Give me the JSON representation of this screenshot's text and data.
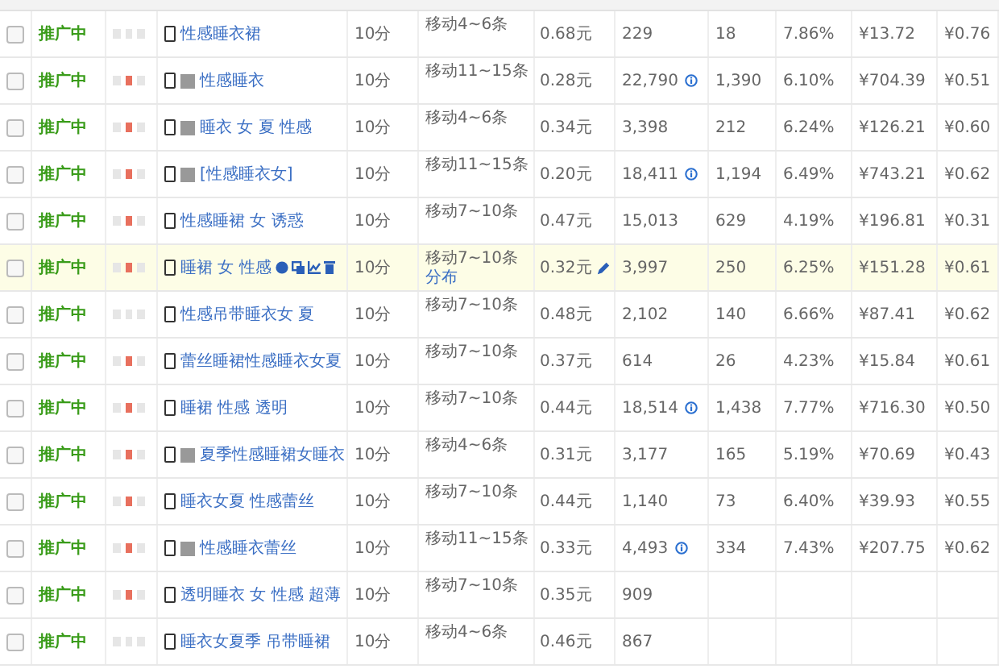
{
  "rows": [
    {
      "checked": false,
      "status": "推广中",
      "flag": false,
      "pc": false,
      "keyword": "性感睡衣裙",
      "score": "10分",
      "ranking": "移动4~6条",
      "bid": "0.68元",
      "impressions": "229",
      "info": false,
      "clicks": "18",
      "ctr": "7.86%",
      "cost": "¥13.72",
      "cpc": "¥0.76",
      "highlighted": false
    },
    {
      "checked": false,
      "status": "推广中",
      "flag": true,
      "pc": true,
      "keyword": "性感睡衣",
      "score": "10分",
      "ranking": "移动11~15条",
      "bid": "0.28元",
      "impressions": "22,790",
      "info": true,
      "clicks": "1,390",
      "ctr": "6.10%",
      "cost": "¥704.39",
      "cpc": "¥0.51",
      "highlighted": false
    },
    {
      "checked": false,
      "status": "推广中",
      "flag": true,
      "pc": true,
      "keyword": "睡衣 女 夏 性感",
      "score": "10分",
      "ranking": "移动4~6条",
      "bid": "0.34元",
      "impressions": "3,398",
      "info": false,
      "clicks": "212",
      "ctr": "6.24%",
      "cost": "¥126.21",
      "cpc": "¥0.60",
      "highlighted": false
    },
    {
      "checked": false,
      "status": "推广中",
      "flag": true,
      "pc": true,
      "keyword": "[性感睡衣女]",
      "score": "10分",
      "ranking": "移动11~15条",
      "bid": "0.20元",
      "impressions": "18,411",
      "info": true,
      "clicks": "1,194",
      "ctr": "6.49%",
      "cost": "¥743.21",
      "cpc": "¥0.62",
      "highlighted": false
    },
    {
      "checked": false,
      "status": "推广中",
      "flag": true,
      "pc": false,
      "keyword": "性感睡裙 女 诱惑",
      "score": "10分",
      "ranking": "移动7~10条",
      "bid": "0.47元",
      "impressions": "15,013",
      "info": false,
      "clicks": "629",
      "ctr": "4.19%",
      "cost": "¥196.81",
      "cpc": "¥0.31",
      "highlighted": false
    },
    {
      "checked": false,
      "status": "推广中",
      "flag": true,
      "pc": false,
      "keyword": "睡裙 女 性感",
      "score": "10分",
      "ranking": "移动7~10条",
      "ranking_link": "分布",
      "bid": "0.32元",
      "impressions": "3,997",
      "info": false,
      "clicks": "250",
      "ctr": "6.25%",
      "cost": "¥151.28",
      "cpc": "¥0.61",
      "highlighted": true
    },
    {
      "checked": false,
      "status": "推广中",
      "flag": false,
      "pc": false,
      "keyword": "性感吊带睡衣女 夏",
      "score": "10分",
      "ranking": "移动7~10条",
      "bid": "0.48元",
      "impressions": "2,102",
      "info": false,
      "clicks": "140",
      "ctr": "6.66%",
      "cost": "¥87.41",
      "cpc": "¥0.62",
      "highlighted": false
    },
    {
      "checked": false,
      "status": "推广中",
      "flag": true,
      "pc": false,
      "keyword": "蕾丝睡裙性感睡衣女夏",
      "score": "10分",
      "ranking": "移动7~10条",
      "bid": "0.37元",
      "impressions": "614",
      "info": false,
      "clicks": "26",
      "ctr": "4.23%",
      "cost": "¥15.84",
      "cpc": "¥0.61",
      "highlighted": false
    },
    {
      "checked": false,
      "status": "推广中",
      "flag": true,
      "pc": false,
      "keyword": "睡裙 性感 透明",
      "score": "10分",
      "ranking": "移动7~10条",
      "bid": "0.44元",
      "impressions": "18,514",
      "info": true,
      "clicks": "1,438",
      "ctr": "7.77%",
      "cost": "¥716.30",
      "cpc": "¥0.50",
      "highlighted": false
    },
    {
      "checked": false,
      "status": "推广中",
      "flag": true,
      "pc": true,
      "keyword": "夏季性感睡裙女睡衣",
      "score": "10分",
      "ranking": "移动4~6条",
      "bid": "0.31元",
      "impressions": "3,177",
      "info": false,
      "clicks": "165",
      "ctr": "5.19%",
      "cost": "¥70.69",
      "cpc": "¥0.43",
      "highlighted": false
    },
    {
      "checked": false,
      "status": "推广中",
      "flag": true,
      "pc": false,
      "keyword": "睡衣女夏 性感蕾丝",
      "score": "10分",
      "ranking": "移动7~10条",
      "bid": "0.44元",
      "impressions": "1,140",
      "info": false,
      "clicks": "73",
      "ctr": "6.40%",
      "cost": "¥39.93",
      "cpc": "¥0.55",
      "highlighted": false
    },
    {
      "checked": false,
      "status": "推广中",
      "flag": true,
      "pc": true,
      "keyword": "性感睡衣蕾丝",
      "score": "10分",
      "ranking": "移动11~15条",
      "bid": "0.33元",
      "impressions": "4,493",
      "info": true,
      "clicks": "334",
      "ctr": "7.43%",
      "cost": "¥207.75",
      "cpc": "¥0.62",
      "highlighted": false
    },
    {
      "checked": false,
      "status": "推广中",
      "flag": true,
      "pc": false,
      "keyword": "透明睡衣 女 性感 超薄",
      "score": "10分",
      "ranking": "移动7~10条",
      "bid": "0.35元",
      "impressions": "909",
      "info": false,
      "highlighted": false
    },
    {
      "checked": false,
      "status": "推广中",
      "flag": false,
      "pc": false,
      "keyword": "睡衣女夏季 吊带睡裙",
      "score": "10分",
      "ranking": "移动4~6条",
      "bid": "0.46元",
      "impressions": "867",
      "info": false,
      "highlighted": false
    }
  ]
}
